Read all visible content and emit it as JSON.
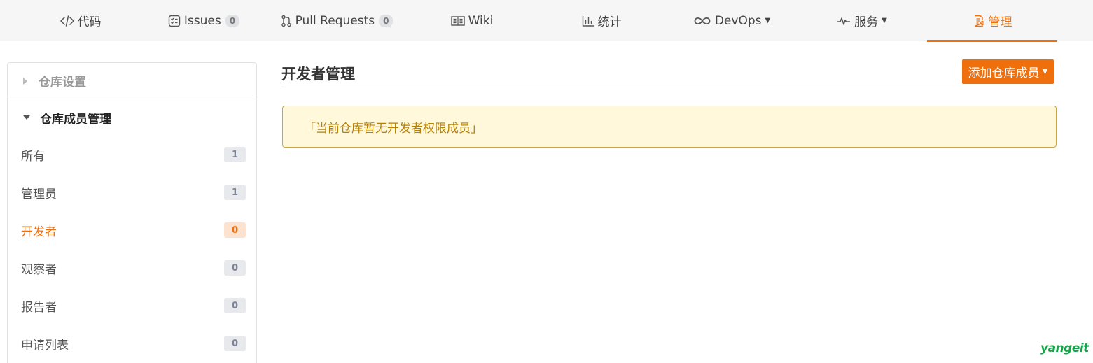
{
  "tabs": [
    {
      "label": "代码",
      "icon": "code-icon"
    },
    {
      "label": "Issues",
      "icon": "issues-icon",
      "count": "0"
    },
    {
      "label": "Pull Requests",
      "icon": "pull-request-icon",
      "count": "0"
    },
    {
      "label": "Wiki",
      "icon": "wiki-book-icon"
    },
    {
      "label": "统计",
      "icon": "bar-chart-icon"
    },
    {
      "label": "DevOps",
      "icon": "infinity-icon"
    },
    {
      "label": "服务",
      "icon": "pulse-icon"
    },
    {
      "label": "管理",
      "icon": "manage-doc-icon",
      "active": true
    }
  ],
  "sidebar": {
    "repo_settings": "仓库设置",
    "member_management": "仓库成员管理",
    "items": [
      {
        "label": "所有",
        "count": "1"
      },
      {
        "label": "管理员",
        "count": "1"
      },
      {
        "label": "开发者",
        "count": "0",
        "active": true
      },
      {
        "label": "观察者",
        "count": "0"
      },
      {
        "label": "报告者",
        "count": "0"
      },
      {
        "label": "申请列表",
        "count": "0"
      }
    ]
  },
  "main": {
    "title": "开发者管理",
    "add_button": "添加仓库成员",
    "notice": "「当前仓库暂无开发者权限成员」"
  },
  "watermark": "yangeit",
  "colors": {
    "accent": "#f06f0d",
    "notice_bg": "#fff8db",
    "notice_text": "#b58105",
    "watermark": "#16a34a"
  }
}
